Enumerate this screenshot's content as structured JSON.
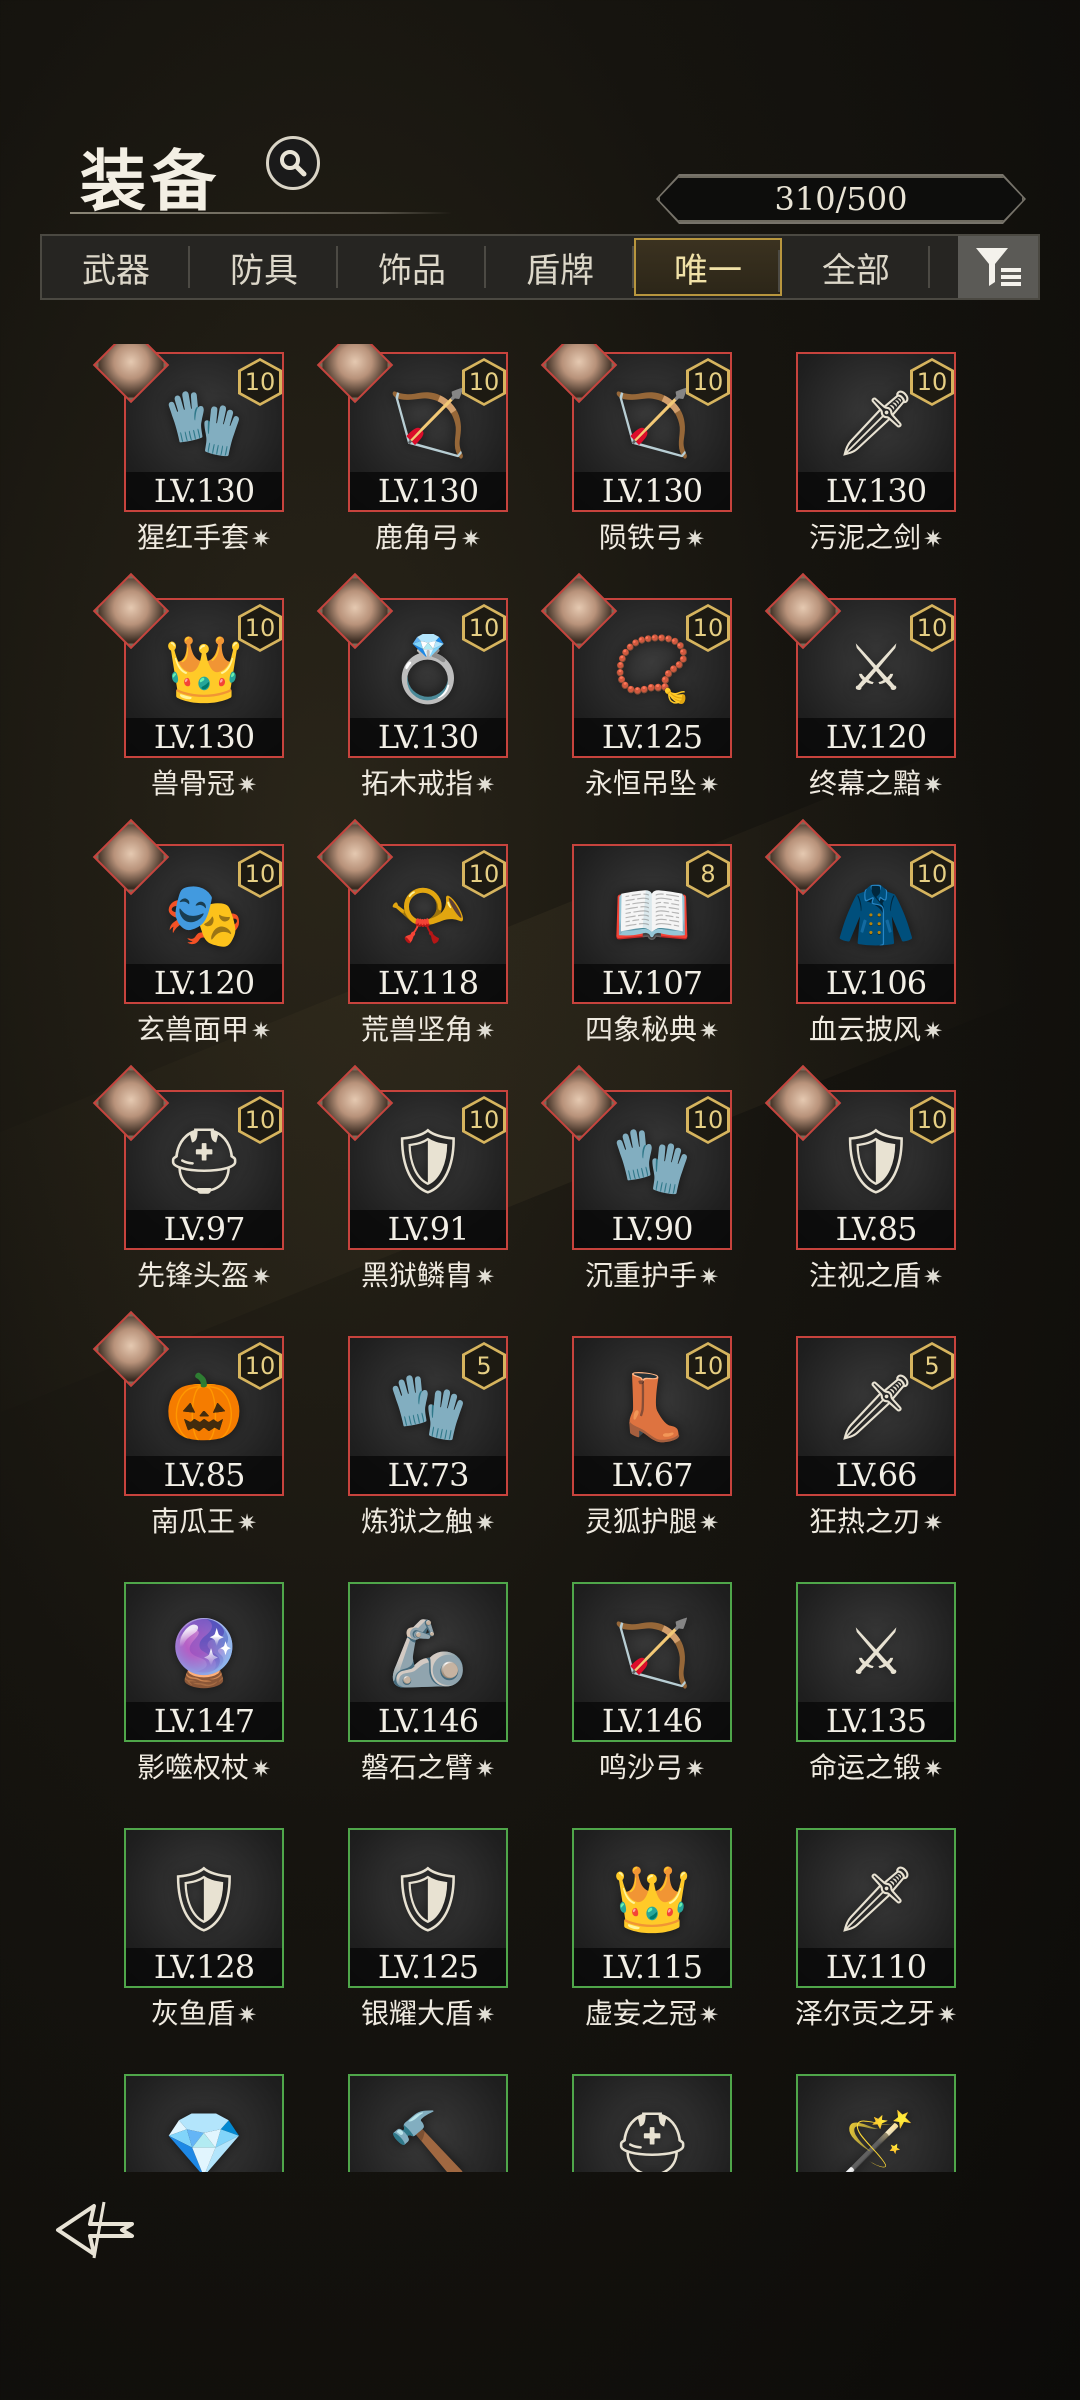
{
  "header": {
    "title": "装备",
    "capacity": "310/500"
  },
  "tabs": [
    {
      "label": "武器",
      "active": false
    },
    {
      "label": "防具",
      "active": false
    },
    {
      "label": "饰品",
      "active": false
    },
    {
      "label": "盾牌",
      "active": false
    },
    {
      "label": "唯一",
      "active": true
    },
    {
      "label": "全部",
      "active": false
    }
  ],
  "colors": {
    "rarity_red": "#c7433d",
    "rarity_green": "#4fa64a",
    "badge_gold": "#d6b45e"
  },
  "items": [
    {
      "level": "LV.130",
      "name": "猩红手套",
      "badge": "10",
      "frame": "red",
      "portrait": true,
      "icon": "gauntlet-icon",
      "glyph": "🧤"
    },
    {
      "level": "LV.130",
      "name": "鹿角弓",
      "badge": "10",
      "frame": "red",
      "portrait": true,
      "icon": "bow-icon",
      "glyph": "🏹"
    },
    {
      "level": "LV.130",
      "name": "陨铁弓",
      "badge": "10",
      "frame": "red",
      "portrait": true,
      "icon": "bow-icon",
      "glyph": "🏹"
    },
    {
      "level": "LV.130",
      "name": "污泥之剑",
      "badge": "10",
      "frame": "red",
      "portrait": false,
      "icon": "sword-icon",
      "glyph": "🗡"
    },
    {
      "level": "LV.130",
      "name": "兽骨冠",
      "badge": "10",
      "frame": "red",
      "portrait": true,
      "icon": "crown-icon",
      "glyph": "👑"
    },
    {
      "level": "LV.130",
      "name": "拓木戒指",
      "badge": "10",
      "frame": "red",
      "portrait": true,
      "icon": "ring-icon",
      "glyph": "💍"
    },
    {
      "level": "LV.125",
      "name": "永恒吊坠",
      "badge": "10",
      "frame": "red",
      "portrait": true,
      "icon": "pendant-icon",
      "glyph": "📿"
    },
    {
      "level": "LV.120",
      "name": "终幕之黯",
      "badge": "10",
      "frame": "red",
      "portrait": true,
      "icon": "sword-icon",
      "glyph": "⚔"
    },
    {
      "level": "LV.120",
      "name": "玄兽面甲",
      "badge": "10",
      "frame": "red",
      "portrait": true,
      "icon": "mask-icon",
      "glyph": "🎭"
    },
    {
      "level": "LV.118",
      "name": "荒兽坚角",
      "badge": "10",
      "frame": "red",
      "portrait": true,
      "icon": "horn-icon",
      "glyph": "📯"
    },
    {
      "level": "LV.107",
      "name": "四象秘典",
      "badge": "8",
      "frame": "red",
      "portrait": false,
      "icon": "tome-icon",
      "glyph": "📖"
    },
    {
      "level": "LV.106",
      "name": "血云披风",
      "badge": "10",
      "frame": "red",
      "portrait": true,
      "icon": "cloak-icon",
      "glyph": "🧥"
    },
    {
      "level": "LV.97",
      "name": "先锋头盔",
      "badge": "10",
      "frame": "red",
      "portrait": true,
      "icon": "helmet-icon",
      "glyph": "⛑"
    },
    {
      "level": "LV.91",
      "name": "黑狱鳞胄",
      "badge": "10",
      "frame": "red",
      "portrait": true,
      "icon": "armor-icon",
      "glyph": "🛡"
    },
    {
      "level": "LV.90",
      "name": "沉重护手",
      "badge": "10",
      "frame": "red",
      "portrait": true,
      "icon": "gauntlet-icon",
      "glyph": "🧤"
    },
    {
      "level": "LV.85",
      "name": "注视之盾",
      "badge": "10",
      "frame": "red",
      "portrait": true,
      "icon": "shield-icon",
      "glyph": "🛡"
    },
    {
      "level": "LV.85",
      "name": "南瓜王",
      "badge": "10",
      "frame": "red",
      "portrait": true,
      "icon": "pumpkin-icon",
      "glyph": "🎃"
    },
    {
      "level": "LV.73",
      "name": "炼狱之触",
      "badge": "5",
      "frame": "red",
      "portrait": false,
      "icon": "gauntlet-icon",
      "glyph": "🧤"
    },
    {
      "level": "LV.67",
      "name": "灵狐护腿",
      "badge": "10",
      "frame": "red",
      "portrait": false,
      "icon": "boots-icon",
      "glyph": "👢"
    },
    {
      "level": "LV.66",
      "name": "狂热之刃",
      "badge": "5",
      "frame": "red",
      "portrait": false,
      "icon": "sword-icon",
      "glyph": "🗡"
    },
    {
      "level": "LV.147",
      "name": "影噬权杖",
      "badge": "",
      "frame": "green",
      "portrait": false,
      "icon": "scepter-icon",
      "glyph": "🔮"
    },
    {
      "level": "LV.146",
      "name": "磐石之臂",
      "badge": "",
      "frame": "green",
      "portrait": false,
      "icon": "gauntlet-icon",
      "glyph": "🦾"
    },
    {
      "level": "LV.146",
      "name": "鸣沙弓",
      "badge": "",
      "frame": "green",
      "portrait": false,
      "icon": "bow-icon",
      "glyph": "🏹"
    },
    {
      "level": "LV.135",
      "name": "命运之锻",
      "badge": "",
      "frame": "green",
      "portrait": false,
      "icon": "sword-icon",
      "glyph": "⚔"
    },
    {
      "level": "LV.128",
      "name": "灰鱼盾",
      "badge": "",
      "frame": "green",
      "portrait": false,
      "icon": "shield-icon",
      "glyph": "🛡"
    },
    {
      "level": "LV.125",
      "name": "银耀大盾",
      "badge": "",
      "frame": "green",
      "portrait": false,
      "icon": "shield-icon",
      "glyph": "🛡"
    },
    {
      "level": "LV.115",
      "name": "虚妄之冠",
      "badge": "",
      "frame": "green",
      "portrait": false,
      "icon": "crown-icon",
      "glyph": "👑"
    },
    {
      "level": "LV.110",
      "name": "泽尔贡之牙",
      "badge": "",
      "frame": "green",
      "portrait": false,
      "icon": "dagger-icon",
      "glyph": "🗡"
    },
    {
      "level": "",
      "name": "",
      "badge": "",
      "frame": "green",
      "portrait": false,
      "icon": "crystal-icon",
      "glyph": "💎"
    },
    {
      "level": "",
      "name": "",
      "badge": "",
      "frame": "green",
      "portrait": false,
      "icon": "mace-icon",
      "glyph": "🔨"
    },
    {
      "level": "",
      "name": "",
      "badge": "",
      "frame": "green",
      "portrait": false,
      "icon": "helmet-icon",
      "glyph": "⛑"
    },
    {
      "level": "",
      "name": "",
      "badge": "",
      "frame": "green",
      "portrait": false,
      "icon": "staff-icon",
      "glyph": "🪄"
    }
  ]
}
